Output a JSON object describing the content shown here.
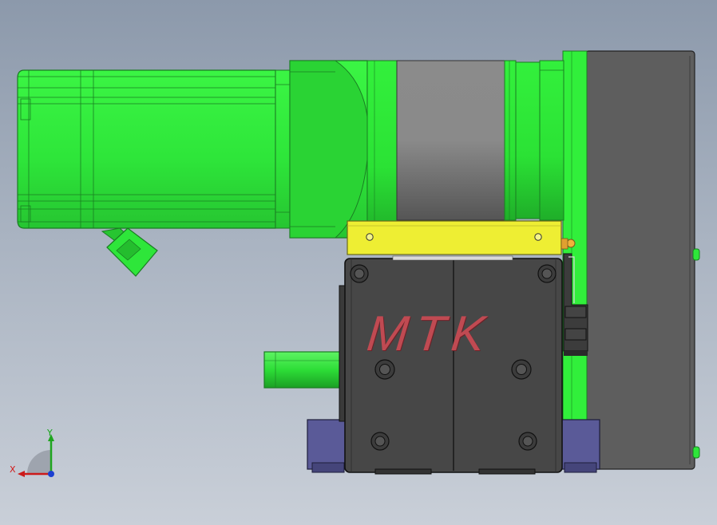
{
  "model": {
    "brand_text": "MTK",
    "colors": {
      "background_top": "#8c99ab",
      "background_bottom": "#c9cfd8",
      "motor_green": "#2ef03a",
      "bracket_yellow": "#eeee33",
      "block_dark": "#454545",
      "plate_gray": "#5d5d5d",
      "foot_purple": "#4f4f8c",
      "label_red": "#c04a52"
    }
  },
  "triad": {
    "x_label": "X",
    "y_label": "Y"
  }
}
